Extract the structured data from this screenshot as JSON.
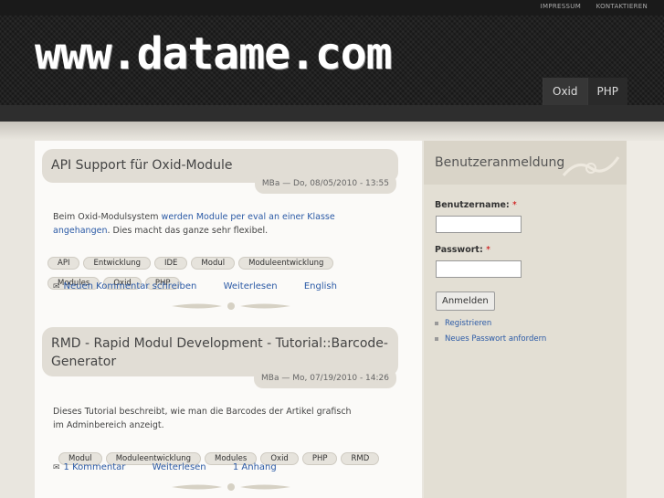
{
  "toplinks": {
    "impressum": "IMPRESSUM",
    "kontakt": "KONTAKTIEREN"
  },
  "logo": "www.datame.com",
  "nav": [
    {
      "label": "Oxid"
    },
    {
      "label": "PHP"
    }
  ],
  "posts": [
    {
      "title": "API Support für Oxid-Module",
      "meta": "MBa — Do, 08/05/2010 - 13:55",
      "text_pre": "Beim Oxid-Modulsystem ",
      "text_link": "werden Module per eval an einer Klasse angehangen",
      "text_post": ". Dies macht das ganze sehr flexibel.",
      "tags": [
        "API",
        "Entwicklung",
        "IDE",
        "Modul",
        "Moduleentwicklung",
        "Modules",
        "Oxid",
        "PHP"
      ],
      "links": [
        "Neuen Kommentar schreiben",
        "Weiterlesen",
        "English"
      ]
    },
    {
      "title": "RMD - Rapid Modul Development - Tutorial::Barcode-Generator",
      "meta": "MBa — Mo, 07/19/2010 - 14:26",
      "text": "Dieses Tutorial beschreibt, wie man die Barcodes der Artikel grafisch im Adminbereich anzeigt.",
      "tags": [
        "Modul",
        "Moduleentwicklung",
        "Modules",
        "Oxid",
        "PHP",
        "RMD"
      ],
      "links": [
        "1 Kommentar",
        "Weiterlesen",
        "1 Anhang"
      ]
    }
  ],
  "sidebar": {
    "title": "Benutzeranmeldung",
    "username_label": "Benutzername:",
    "password_label": "Passwort:",
    "required_mark": "*",
    "login_button": "Anmelden",
    "links": [
      "Registrieren",
      "Neues Passwort anfordern"
    ]
  }
}
